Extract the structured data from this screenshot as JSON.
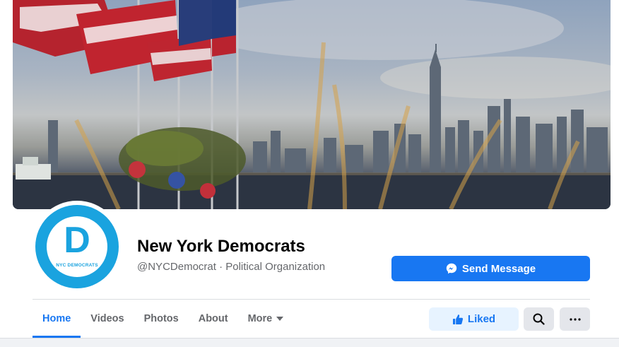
{
  "page": {
    "name": "New York Democrats",
    "meta": "@NYCDemocrat · Political Organization"
  },
  "avatar": {
    "letter": "D",
    "caption": "NYC DEMOCRATS"
  },
  "actions": {
    "send_message": "Send Message",
    "liked": "Liked"
  },
  "tabs": [
    {
      "label": "Home",
      "active": true
    },
    {
      "label": "Videos"
    },
    {
      "label": "Photos"
    },
    {
      "label": "About"
    },
    {
      "label": "More"
    }
  ],
  "colors": {
    "accent": "#1877f2",
    "avatar_blue": "#1aa3df",
    "liked_bg": "#e7f3ff",
    "secondary_btn_bg": "#e4e6eb"
  },
  "icons": {
    "send": "messenger-icon",
    "liked": "thumbs-up-icon",
    "search": "search-icon",
    "more": "ellipsis-icon",
    "tab_more": "caret-down-icon"
  }
}
